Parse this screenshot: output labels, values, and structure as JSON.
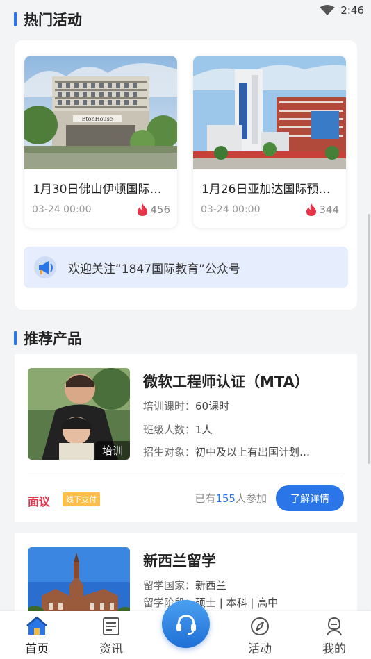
{
  "status_bar": {
    "time": "2:46"
  },
  "hot_activities": {
    "section_title": "热门活动",
    "items": [
      {
        "title": "1月30日佛山伊顿国际…",
        "time": "03-24 00:00",
        "heat": "456",
        "image_sign": "EtonHouse"
      },
      {
        "title": "1月26日亚加达国际预…",
        "time": "03-24 00:00",
        "heat": "344"
      }
    ],
    "notice": "欢迎关注“1847国际教育”公众号"
  },
  "recommended": {
    "section_title": "推荐产品",
    "products": [
      {
        "name": "微软工程师认证（MTA）",
        "tag": "培训",
        "rows": [
          {
            "key": "培训课时：",
            "value": "60课时"
          },
          {
            "key": "班级人数：",
            "value": "1人"
          },
          {
            "key": "招生对象：",
            "value": "初中及以上有出国计划…"
          }
        ],
        "price": "面议",
        "pay_badge": "线下支付",
        "joined_prefix": "已有",
        "joined_count": "155",
        "joined_suffix": "人参加",
        "detail_button": "了解详情"
      },
      {
        "name": "新西兰留学",
        "rows": [
          {
            "key": "留学国家：",
            "value": "新西兰"
          },
          {
            "key": "留学阶段：",
            "value": "硕士 | 本科 | 高中"
          }
        ]
      }
    ]
  },
  "tabbar": {
    "items": [
      {
        "label": "首页",
        "icon": "home-icon",
        "active": true
      },
      {
        "label": "资讯",
        "icon": "news-icon"
      },
      {
        "label": "活动",
        "icon": "compass-icon"
      },
      {
        "label": "我的",
        "icon": "profile-icon"
      }
    ],
    "center_icon": "headset-icon"
  },
  "colors": {
    "accent": "#2a76e8",
    "price": "#e8344a",
    "badge": "#fbbf4a",
    "notice_bg": "#e6eefd"
  }
}
